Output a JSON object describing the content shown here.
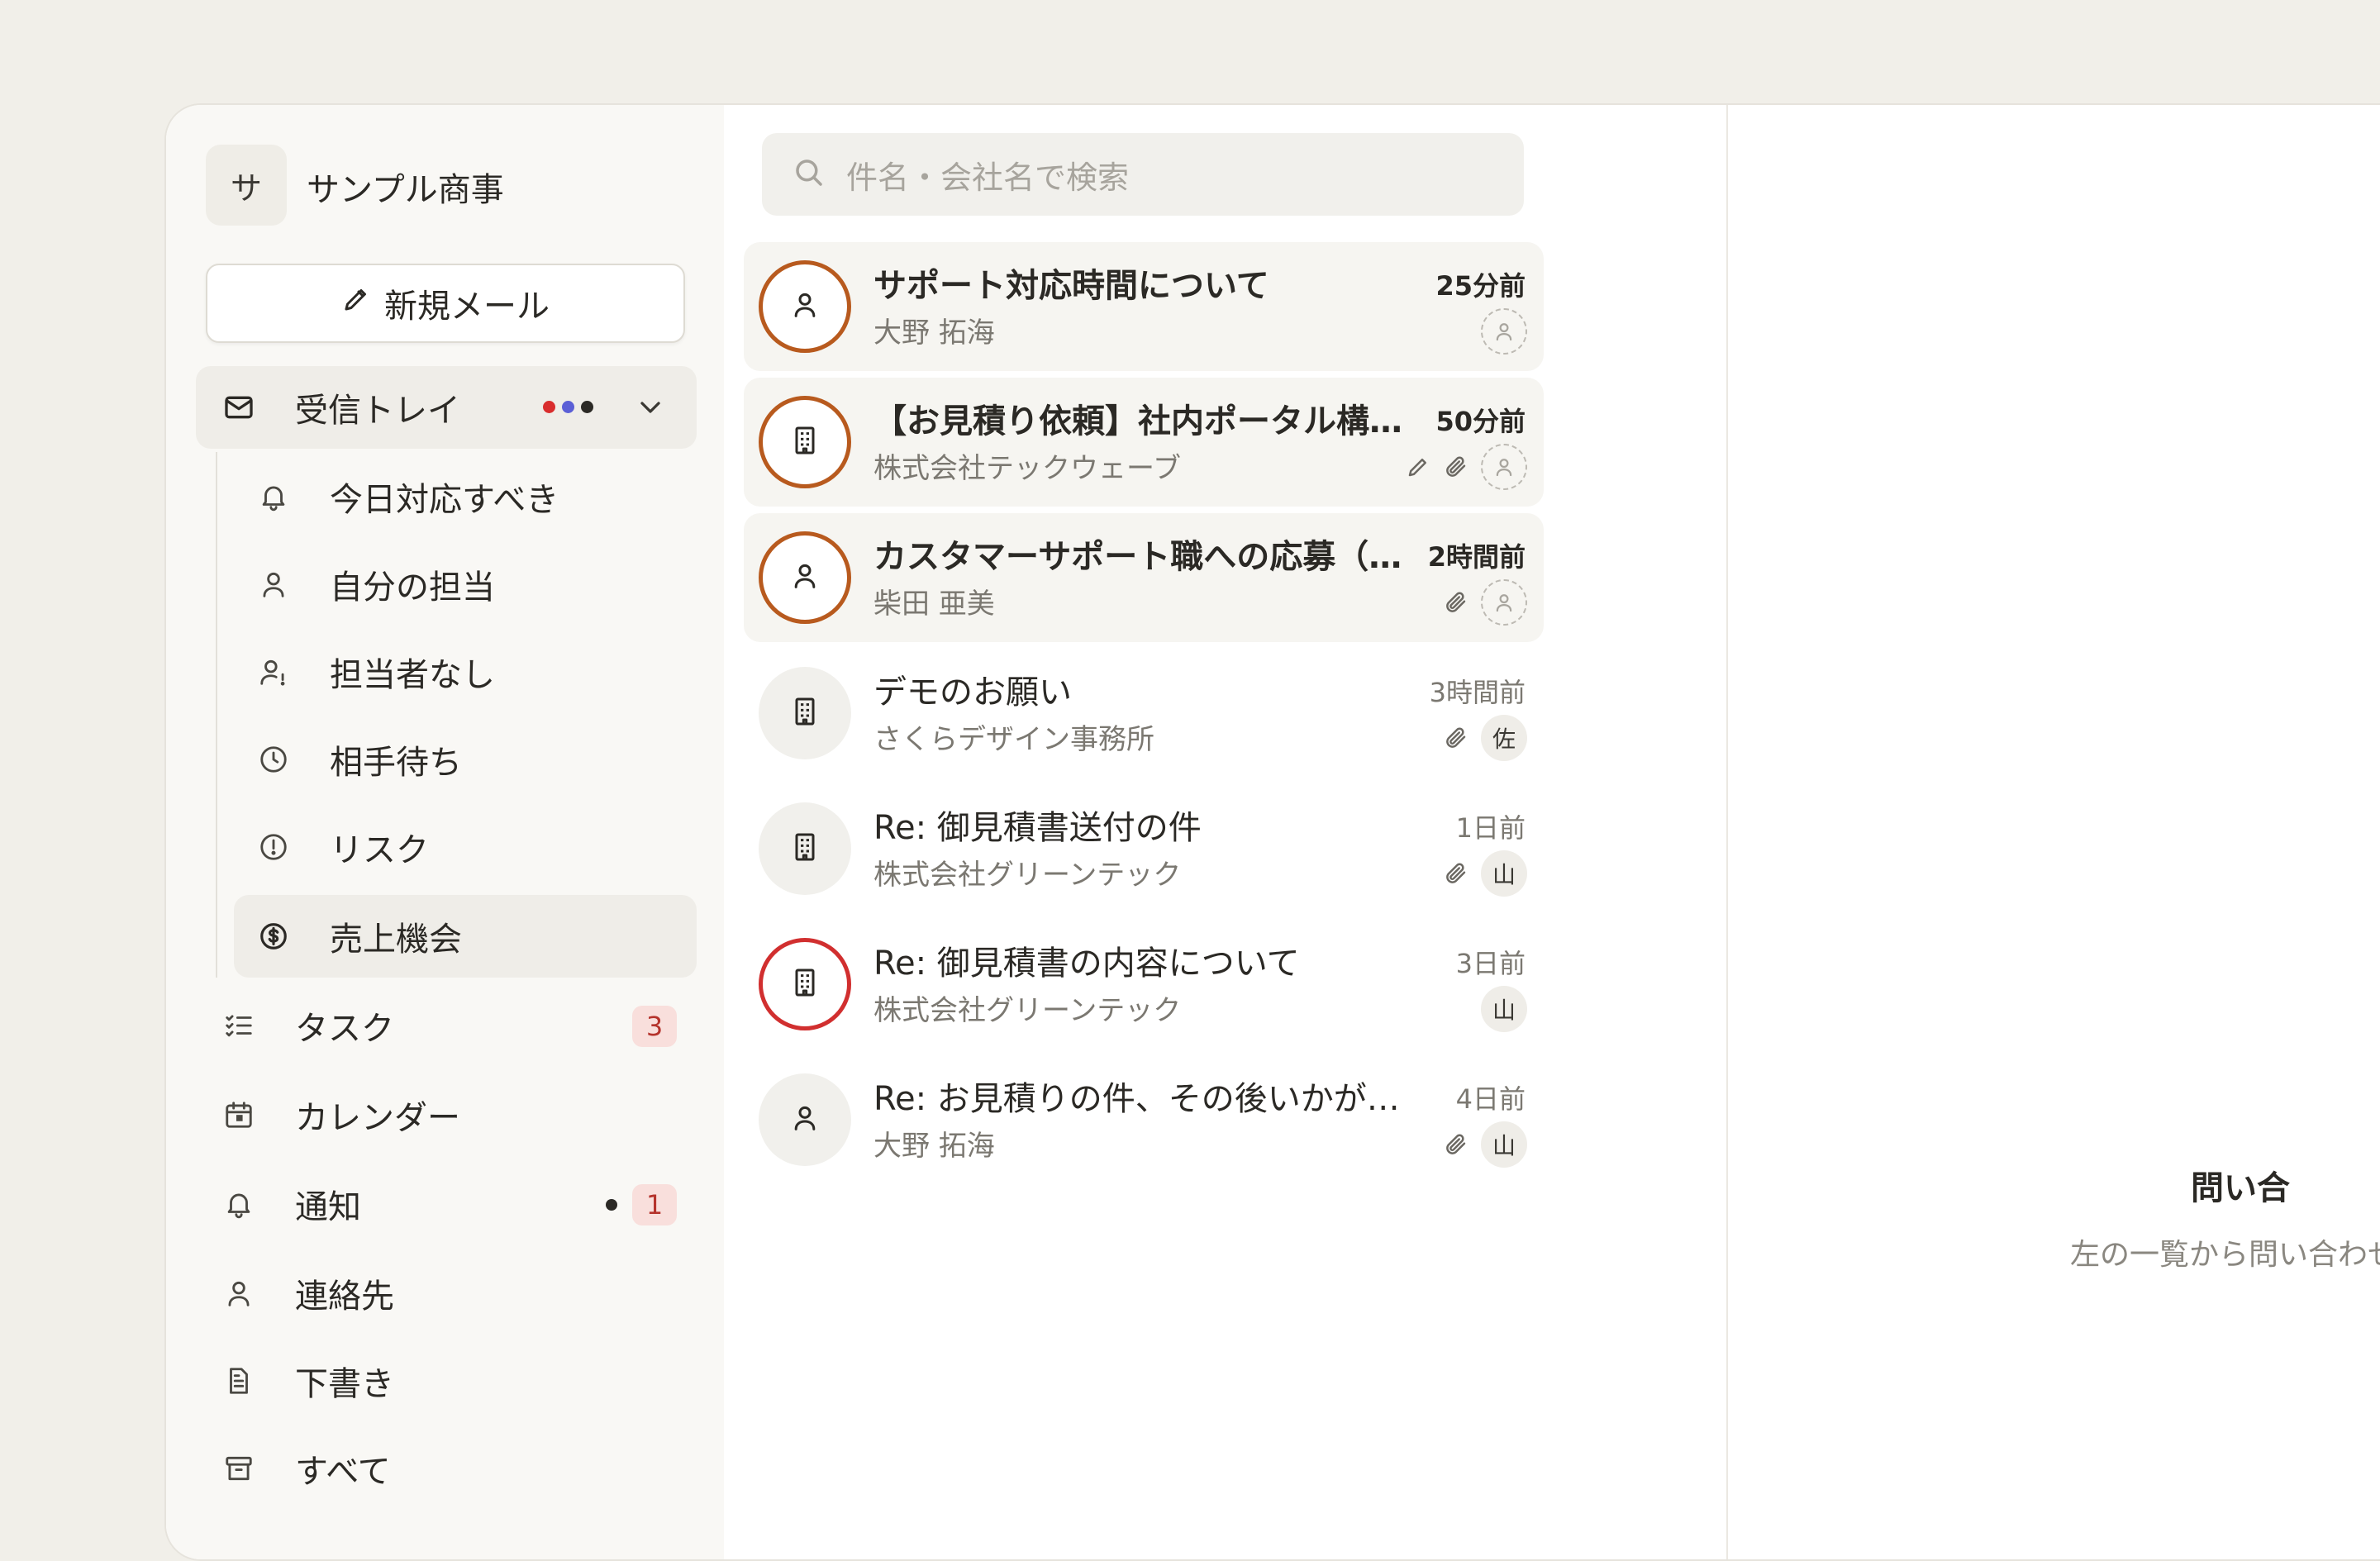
{
  "workspace": {
    "avatar": "サ",
    "name": "サンプル商事"
  },
  "compose": {
    "label": "新規メール",
    "icon": "pencil-icon"
  },
  "inbox": {
    "label": "受信トレイ",
    "status_dots": [
      "#d92d2d",
      "#5b5fd6",
      "#2b2925"
    ],
    "sub_items": [
      {
        "label": "今日対応すべき",
        "icon": "bell-icon"
      },
      {
        "label": "自分の担当",
        "icon": "person-icon"
      },
      {
        "label": "担当者なし",
        "icon": "person-alert-icon"
      },
      {
        "label": "相手待ち",
        "icon": "clock-icon"
      },
      {
        "label": "リスク",
        "icon": "alert-circle-icon"
      },
      {
        "label": "売上機会",
        "icon": "dollar-circle-icon",
        "active": true
      }
    ]
  },
  "nav": [
    {
      "label": "タスク",
      "icon": "checklist-icon",
      "badge": "3"
    },
    {
      "label": "カレンダー",
      "icon": "calendar-icon"
    },
    {
      "label": "通知",
      "icon": "bell-icon",
      "badge": "1",
      "dot": true
    },
    {
      "label": "連絡先",
      "icon": "person-icon"
    },
    {
      "label": "下書き",
      "icon": "document-icon"
    },
    {
      "label": "すべて",
      "icon": "archive-icon"
    }
  ],
  "search": {
    "placeholder": "件名・会社名で検索"
  },
  "messages": [
    {
      "subject": "サポート対応時間について",
      "sender": "大野 拓海",
      "time": "25分前",
      "unread": true,
      "avatar": "person",
      "ring": "orange",
      "draft": false,
      "attachment": false,
      "assignee": ""
    },
    {
      "subject": "【お見積り依頼】社内ポータル構築について",
      "sender": "株式会社テックウェーブ",
      "time": "50分前",
      "unread": true,
      "avatar": "building",
      "ring": "orange",
      "draft": true,
      "attachment": true,
      "assignee": ""
    },
    {
      "subject": "カスタマーサポート職への応募（山田）",
      "sender": "柴田 亜美",
      "time": "2時間前",
      "unread": true,
      "avatar": "person",
      "ring": "orange",
      "draft": false,
      "attachment": true,
      "assignee": ""
    },
    {
      "subject": "デモのお願い",
      "sender": "さくらデザイン事務所",
      "time": "3時間前",
      "unread": false,
      "avatar": "building",
      "ring": "",
      "draft": false,
      "attachment": true,
      "assignee": "佐"
    },
    {
      "subject": "Re: 御見積書送付の件",
      "sender": "株式会社グリーンテック",
      "time": "1日前",
      "unread": false,
      "avatar": "building",
      "ring": "",
      "draft": false,
      "attachment": true,
      "assignee": "山"
    },
    {
      "subject": "Re: 御見積書の内容について",
      "sender": "株式会社グリーンテック",
      "time": "3日前",
      "unread": false,
      "avatar": "building",
      "ring": "red",
      "draft": false,
      "attachment": false,
      "assignee": "山"
    },
    {
      "subject": "Re: お見積りの件、その後いかがでしょうか",
      "sender": "大野 拓海",
      "time": "4日前",
      "unread": false,
      "avatar": "person",
      "ring": "",
      "draft": false,
      "attachment": true,
      "assignee": "山"
    }
  ],
  "detail": {
    "empty_title": "問い合",
    "empty_description": "左の一覧から問い合わせを開くと"
  },
  "colors": {
    "ring_orange": "#b85a1e",
    "ring_red": "#d12f2f",
    "badge_bg": "#f9dfdc",
    "badge_text": "#b5332c"
  }
}
